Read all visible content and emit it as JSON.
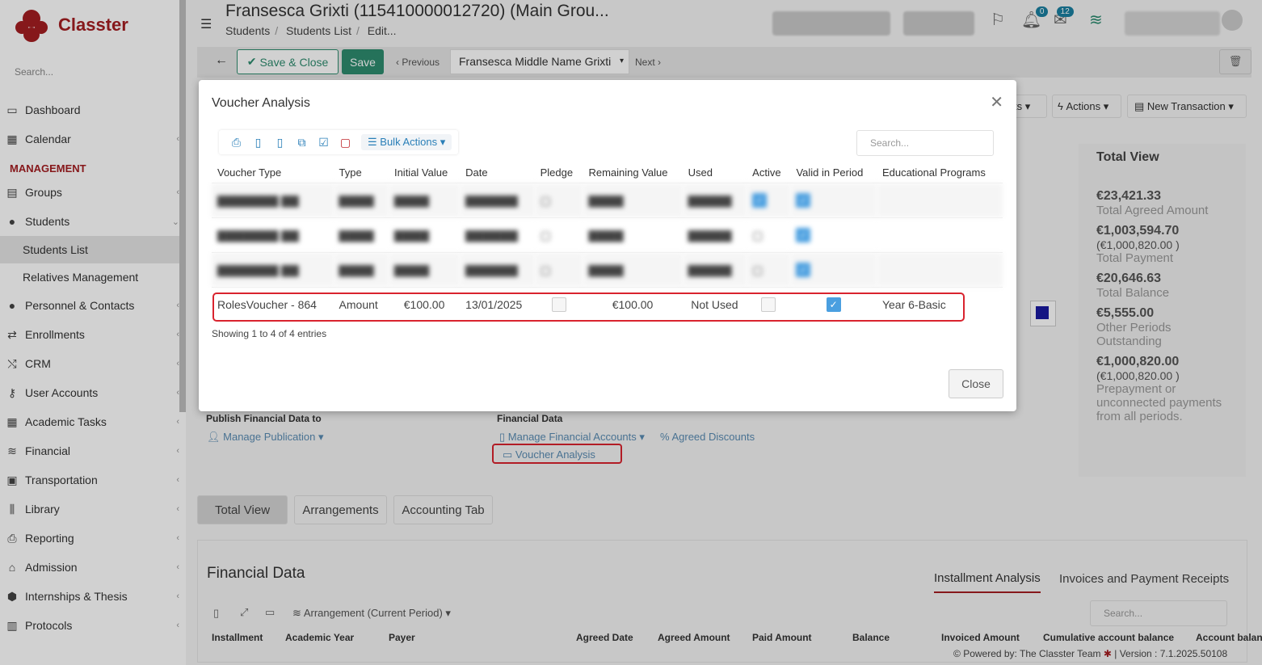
{
  "sidebar": {
    "logo_text": "Classter",
    "search_placeholder": "Search...",
    "items": [
      {
        "label": "Dashboard",
        "icon": "monitor-icon"
      },
      {
        "label": "Calendar",
        "icon": "calendar-icon"
      }
    ],
    "section_label": "MANAGEMENT",
    "management_items": [
      {
        "label": "Groups",
        "icon": "groups-icon"
      },
      {
        "label": "Students",
        "icon": "students-icon"
      }
    ],
    "students_sub": [
      "Students List",
      "Relatives Management"
    ],
    "more_items": [
      {
        "label": "Personnel & Contacts",
        "icon": "personnel-icon"
      },
      {
        "label": "Enrollments",
        "icon": "enrollments-icon"
      },
      {
        "label": "CRM",
        "icon": "crm-icon"
      },
      {
        "label": "User Accounts",
        "icon": "key-icon"
      },
      {
        "label": "Academic Tasks",
        "icon": "tasks-icon"
      },
      {
        "label": "Financial",
        "icon": "coins-icon"
      },
      {
        "label": "Transportation",
        "icon": "bus-icon"
      },
      {
        "label": "Library",
        "icon": "library-icon"
      },
      {
        "label": "Reporting",
        "icon": "printer-icon"
      },
      {
        "label": "Admission",
        "icon": "building-icon"
      },
      {
        "label": "Internships & Thesis",
        "icon": "box-icon"
      },
      {
        "label": "Protocols",
        "icon": "protocols-icon"
      }
    ]
  },
  "header": {
    "title": "Fransesca Grixti (115410000012720) (Main Grou...",
    "breadcrumb": [
      "Students",
      "Students List",
      "Edit..."
    ],
    "notifications_count": "0",
    "messages_count": "12"
  },
  "toolbar": {
    "save_close_label": "Save & Close",
    "save_label": "Save",
    "previous_label": "Previous",
    "record_select": "Fransesca Middle Name Grixti",
    "next_label": "Next",
    "actions_label": "Actions",
    "new_transaction_label": "New Transaction"
  },
  "modal": {
    "title": "Voucher Analysis",
    "bulk_actions_label": "Bulk Actions",
    "search_placeholder": "Search...",
    "columns": [
      "Voucher Type",
      "Type",
      "Initial Value",
      "Date",
      "Pledge",
      "Remaining Value",
      "Used",
      "Active",
      "Valid in Period",
      "Educational Programs"
    ],
    "highlight_row": {
      "voucher_type": "RolesVoucher - 864",
      "type": "Amount",
      "initial_value": "€100.00",
      "date": "13/01/2025",
      "pledge": false,
      "remaining_value": "€100.00",
      "used": "Not Used",
      "active": false,
      "valid_in_period": true,
      "educational_programs": "Year 6-Basic"
    },
    "entries_text": "Showing 1 to 4 of 4 entries",
    "close_label": "Close"
  },
  "background": {
    "publish_label": "Publish Financial Data to",
    "manage_publication": "Manage Publication",
    "financial_data_label": "Financial Data",
    "manage_financial_accounts": "Manage Financial Accounts",
    "agreed_discounts": "Agreed Discounts",
    "voucher_analysis_link": "Voucher Analysis",
    "tabs": [
      "Total View",
      "Arrangements",
      "Accounting Tab"
    ],
    "financial_data_heading": "Financial Data",
    "right_tabs": [
      "Installment Analysis",
      "Invoices and Payment Receipts"
    ],
    "fd_search_placeholder": "Search...",
    "arrangement_select": "Arrangement (Current Period)",
    "fd_columns": [
      "Installment",
      "Academic Year",
      "Payer",
      "Agreed Date",
      "Agreed Amount",
      "Paid Amount",
      "Balance",
      "Invoiced Amount",
      "Cumulative account balance",
      "Account balance"
    ]
  },
  "total_view": {
    "title": "Total View",
    "items": [
      {
        "amount": "€23,421.33",
        "sub": "",
        "label": "Total Agreed Amount"
      },
      {
        "amount": "€1,003,594.70",
        "sub": "(€1,000,820.00 )",
        "label": "Total Payment"
      },
      {
        "amount": "€20,646.63",
        "sub": "",
        "label": "Total Balance"
      },
      {
        "amount": "€5,555.00",
        "sub": "",
        "label": "Other Periods Outstanding"
      },
      {
        "amount": "€1,000,820.00",
        "sub": "(€1,000,820.00 )",
        "label": "Prepayment or unconnected payments from all periods."
      }
    ]
  },
  "footer": {
    "powered_by": "Powered by: The Classter Team",
    "version": "| Version : 7.1.2025.50108"
  },
  "colors": {
    "brand": "#a41e22",
    "save_green": "#2e8b6e",
    "link_blue": "#2a7fb8",
    "highlight_red": "#d9232e"
  }
}
